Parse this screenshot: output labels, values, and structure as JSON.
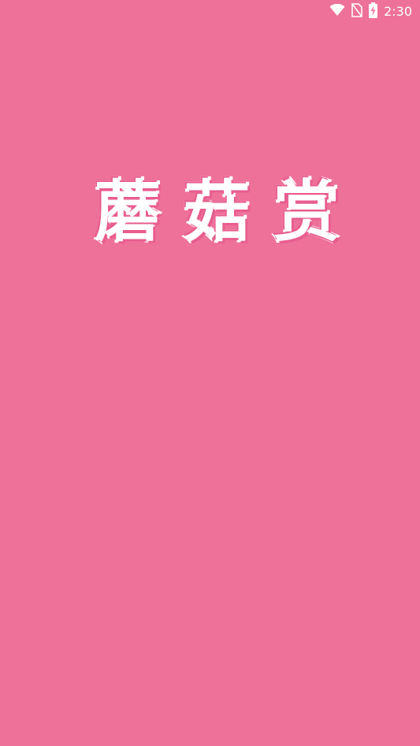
{
  "app": {
    "background_color": "#ee7199",
    "name_chars": [
      "蘑",
      "菇",
      "赏"
    ]
  },
  "status_bar": {
    "time": "2:30",
    "icons": [
      "wifi-icon",
      "no-sim-icon",
      "battery-charging-icon"
    ]
  },
  "colors": {
    "foreground": "#ffffff",
    "accent_shadow": "#e85d8f"
  }
}
